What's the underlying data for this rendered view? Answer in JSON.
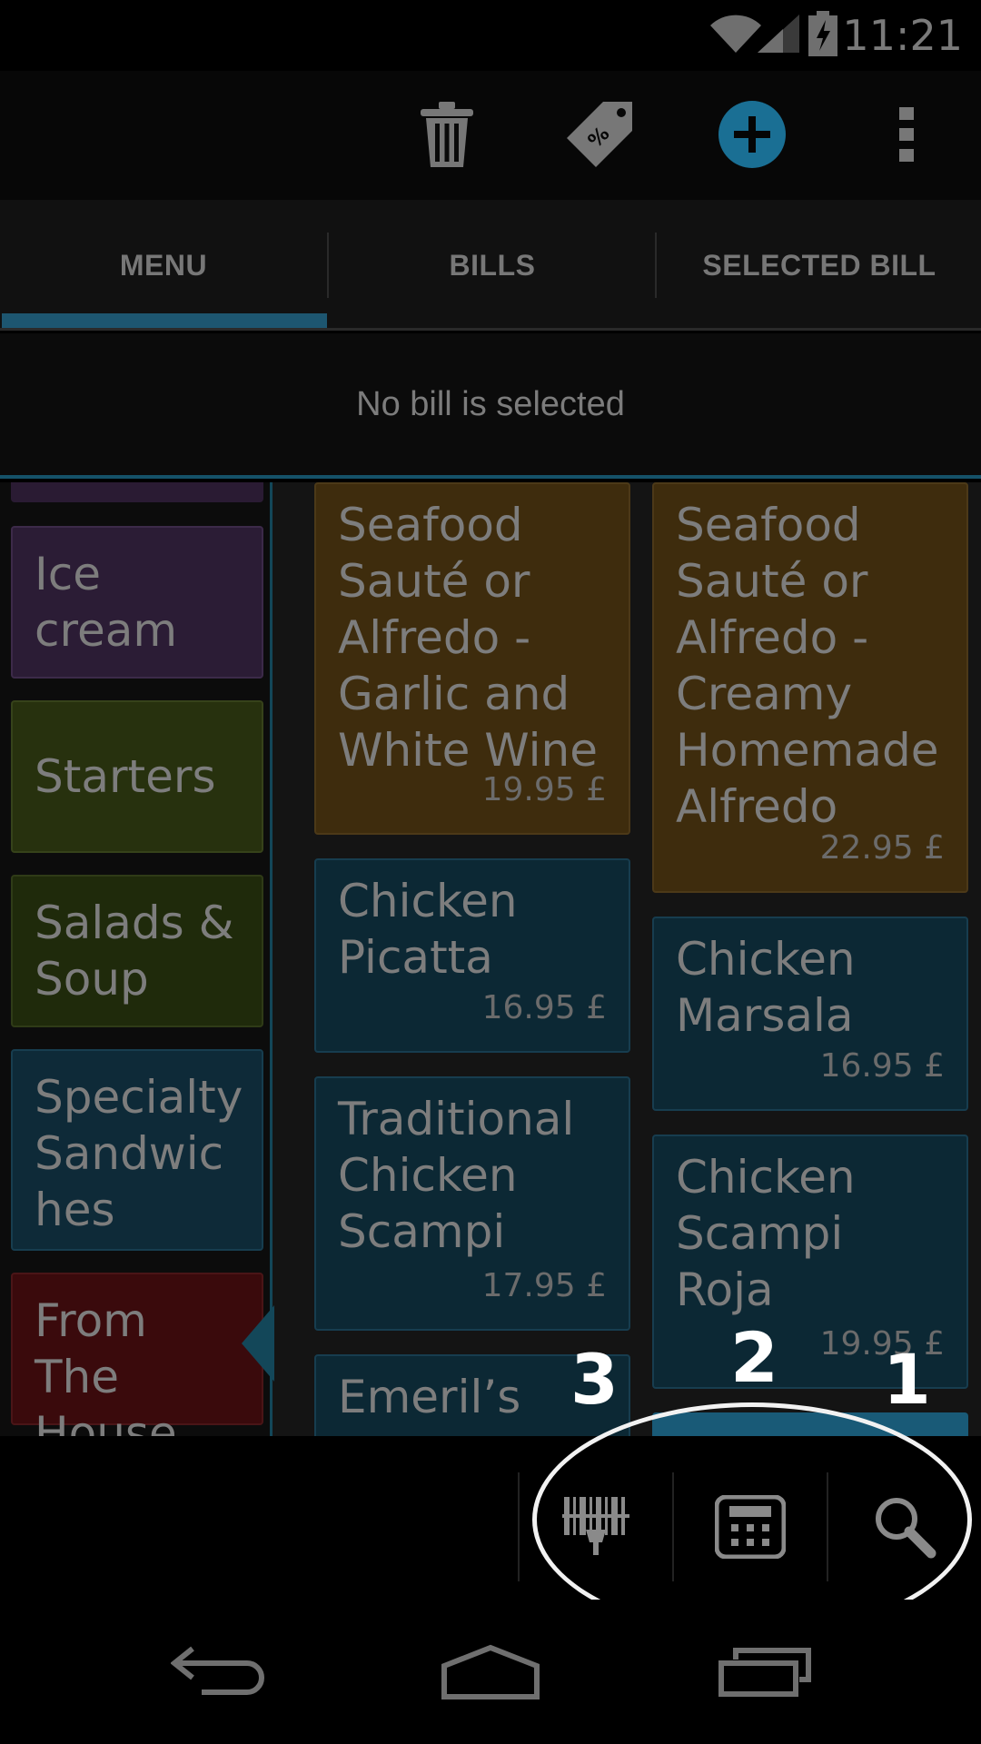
{
  "status_bar": {
    "time": "11:21"
  },
  "tabs": [
    {
      "label": "MENU",
      "selected": true
    },
    {
      "label": "BILLS",
      "selected": false
    },
    {
      "label": "SELECTED BILL",
      "selected": false
    }
  ],
  "bill_status": "No bill is selected",
  "categories": [
    {
      "label": "Ice cream",
      "color": "#2b1c35"
    },
    {
      "label": "Starters",
      "color": "#27310e"
    },
    {
      "label": "Salads & Soup",
      "color": "#1f2a0b"
    },
    {
      "label": "Specialty Sandwiches",
      "color": "#0e2a38"
    },
    {
      "label": "From The House",
      "color": "#3a0a0c",
      "selected": true
    }
  ],
  "category_lines": {
    "icecream": [
      "Ice",
      "cream"
    ],
    "salads": [
      "Salads &",
      "Soup"
    ],
    "sandwiches": [
      "Specialty",
      "Sandwic",
      "hes"
    ],
    "house": [
      "From The",
      "House"
    ]
  },
  "menu_items": [
    {
      "name_lines": [
        "Seafood",
        "Sauté or",
        "Alfredo -",
        "Garlic and",
        "White Wine"
      ],
      "price": "19.95 £"
    },
    {
      "name_lines": [
        "Seafood",
        "Sauté or",
        "Alfredo -",
        "Creamy",
        "Homemade",
        "Alfredo"
      ],
      "price": "22.95 £"
    },
    {
      "name_lines": [
        "Chicken",
        "Picatta"
      ],
      "price": "16.95 £"
    },
    {
      "name_lines": [
        "Chicken",
        "Marsala"
      ],
      "price": "16.95 £"
    },
    {
      "name_lines": [
        "Traditional",
        "Chicken",
        "Scampi"
      ],
      "price": "17.95 £"
    },
    {
      "name_lines": [
        "Chicken",
        "Scampi",
        "Roja"
      ],
      "price": "19.95 £"
    },
    {
      "name_lines": [
        "Emeril’s"
      ],
      "price": ""
    }
  ],
  "bottom_actions": [
    {
      "icon": "barcode-scanner-icon",
      "callout": "3"
    },
    {
      "icon": "calculator-icon",
      "callout": "2"
    },
    {
      "icon": "search-icon",
      "callout": "1"
    }
  ],
  "colors": {
    "accent": "#1d5670",
    "add_button": "#1a6f94",
    "annotation": "#ffffff"
  }
}
